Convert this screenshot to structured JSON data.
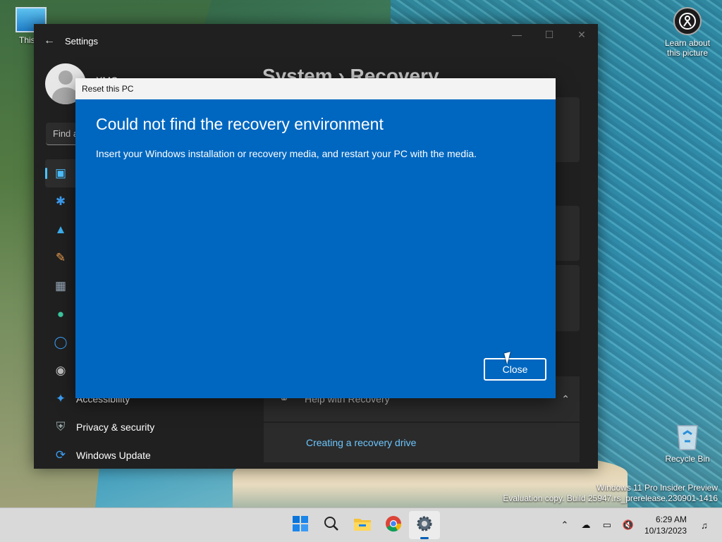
{
  "desktop": {
    "icons": [
      {
        "label": "This P"
      },
      {
        "label": "Learn about this picture"
      },
      {
        "label": "Recycle Bin"
      }
    ],
    "watermark": {
      "line1": "Windows 11 Pro Insider Preview",
      "line2": "Evaluation copy. Build 25947.rs_prerelease.230901-1416"
    }
  },
  "settings": {
    "window_title": "Settings",
    "user_name": "XMC",
    "search_placeholder": "Find a",
    "page_title": "System  ›  Recovery",
    "nav_items": [
      {
        "label": "",
        "icon": "system-icon"
      },
      {
        "label": "",
        "icon": "bluetooth-icon"
      },
      {
        "label": "",
        "icon": "wifi-icon"
      },
      {
        "label": "",
        "icon": "brush-icon"
      },
      {
        "label": "",
        "icon": "apps-icon"
      },
      {
        "label": "",
        "icon": "person-icon"
      },
      {
        "label": "",
        "icon": "time-language-icon"
      },
      {
        "label": "",
        "icon": "gaming-icon"
      },
      {
        "label": "Accessibility",
        "icon": "accessibility-icon"
      },
      {
        "label": "Privacy & security",
        "icon": "shield-icon"
      },
      {
        "label": "Windows Update",
        "icon": "update-icon"
      }
    ],
    "help_section": "Help with Recovery",
    "help_link": "Creating a recovery drive"
  },
  "dialog": {
    "title": "Reset this PC",
    "heading": "Could not find the recovery environment",
    "body": "Insert your Windows installation or recovery media, and restart your PC with the media.",
    "close_label": "Close",
    "color": "#0067c0"
  },
  "taskbar": {
    "apps": [
      "start-icon",
      "search-icon",
      "file-explorer-icon",
      "chrome-icon",
      "settings-icon"
    ],
    "time": "6:29 AM",
    "date": "10/13/2023"
  }
}
